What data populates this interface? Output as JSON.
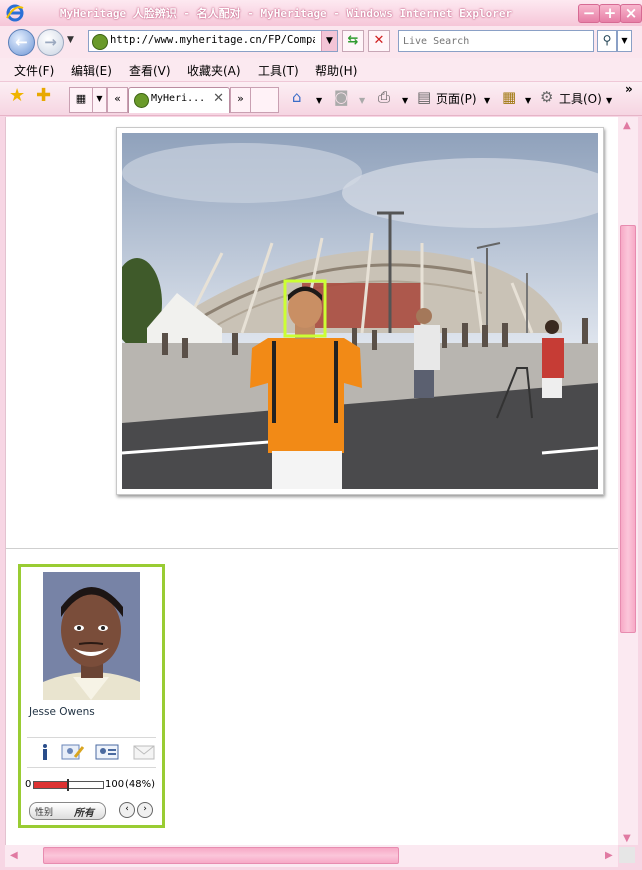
{
  "window": {
    "title": "MyHeritage 人脸辨识 - 名人配对 - MyHeritage - Windows Internet Explorer",
    "controls": [
      "−",
      "+",
      "×"
    ]
  },
  "address_bar": {
    "url": "http://www.myheritage.cn/FP/Company",
    "search_placeholder": "Live Search"
  },
  "menu": {
    "items": [
      "文件(F)",
      "编辑(E)",
      "查看(V)",
      "收藏夹(A)",
      "工具(T)",
      "帮助(H)"
    ]
  },
  "tabs": {
    "active_label": "MyHeri...",
    "prev_label": "«",
    "next_label": "»"
  },
  "commands": {
    "page_label": "页面(P)",
    "tools_label": "工具(O)",
    "more_label": "»"
  },
  "match_card": {
    "celebrity_name": "Jesse Owens",
    "slider_min": "0",
    "slider_max": "100",
    "similarity_percent_text": "(48%)",
    "similarity_value": 0.48,
    "gender_label": "性别",
    "gender_value": "所有",
    "prev": "‹",
    "next": "›"
  },
  "colors": {
    "accent_pink": "#f7a9c6",
    "card_border_green": "#99cc33",
    "face_box_green": "#ccff33"
  }
}
